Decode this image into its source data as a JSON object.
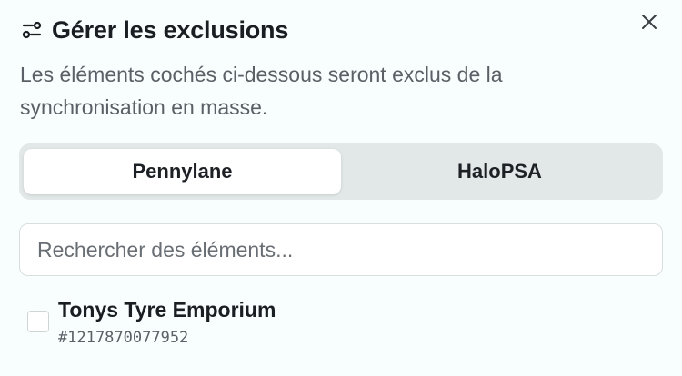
{
  "dialog": {
    "title": "Gérer les exclusions",
    "title_icon": "sliders-icon",
    "close_icon": "close-icon",
    "description": "Les éléments cochés ci-dessous seront exclus de la synchronisation en masse."
  },
  "tabs": [
    {
      "label": "Pennylane",
      "active": true
    },
    {
      "label": "HaloPSA",
      "active": false
    }
  ],
  "search": {
    "placeholder": "Rechercher des éléments...",
    "value": ""
  },
  "items": [
    {
      "name": "Tonys Tyre Emporium",
      "id": "#1217870077952",
      "checked": false
    }
  ],
  "colors": {
    "background": "#f8fdfd",
    "tab_track": "#e2e8e8",
    "text_primary": "#1a1e22",
    "text_secondary": "#5a6066"
  }
}
